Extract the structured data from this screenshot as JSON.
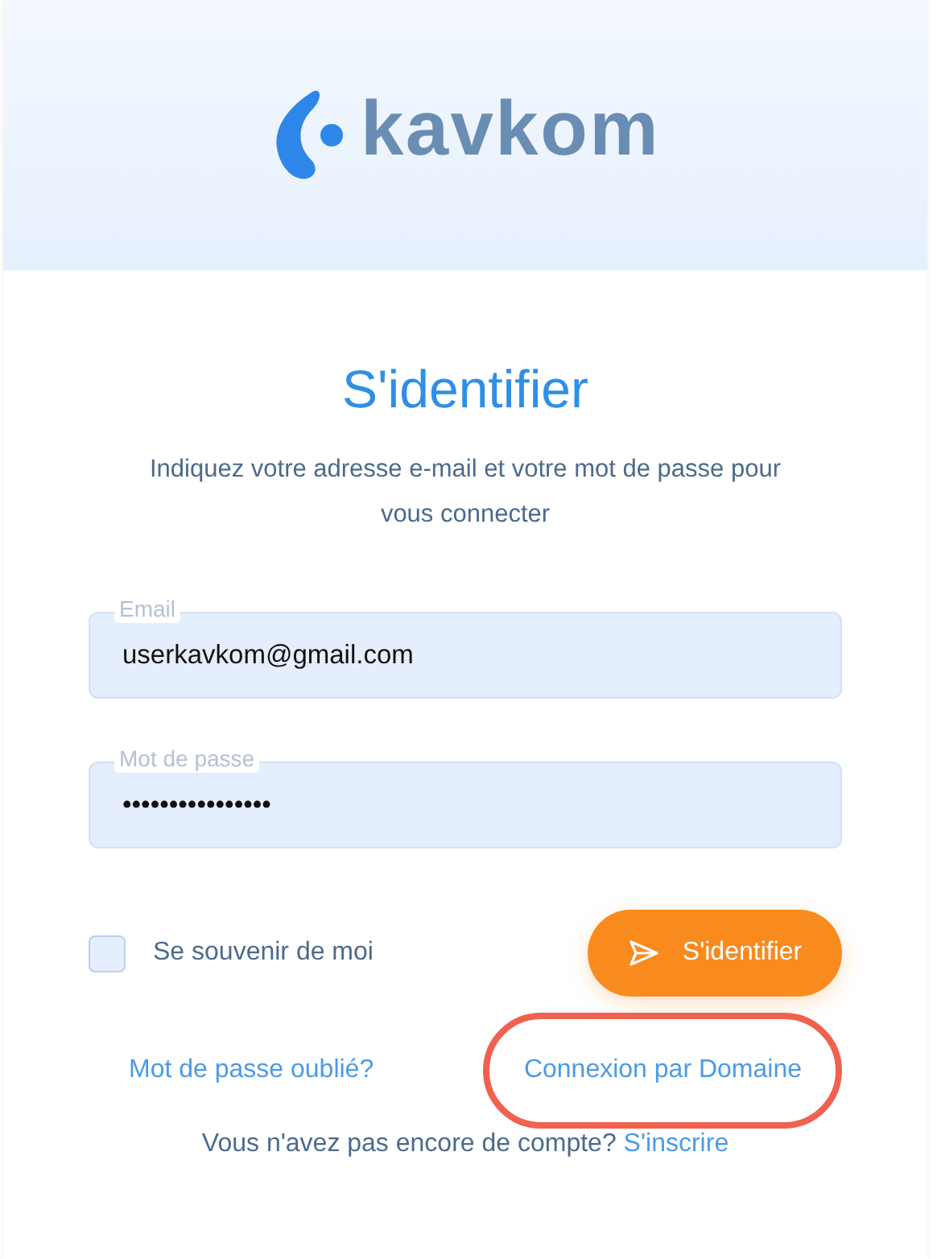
{
  "logo": {
    "text": "kavkom"
  },
  "title": "S'identifier",
  "subtitle": "Indiquez votre adresse e-mail et votre mot de passe pour vous connecter",
  "fields": [
    {
      "label": "Email",
      "value": "userkavkom@gmail.com"
    },
    {
      "label": "Mot de passe",
      "value": "••••••••••••••••"
    }
  ],
  "remember": {
    "label": "Se souvenir de moi",
    "checked": false
  },
  "submit_button": {
    "label": "S'identifier"
  },
  "links": [
    {
      "label": "Mot de passe oublié?",
      "highlighted": false
    },
    {
      "label": "Connexion par Domaine",
      "highlighted": true
    }
  ],
  "signup": {
    "text": "Vous n'avez pas encore de compte?",
    "link": "S'inscrire"
  }
}
